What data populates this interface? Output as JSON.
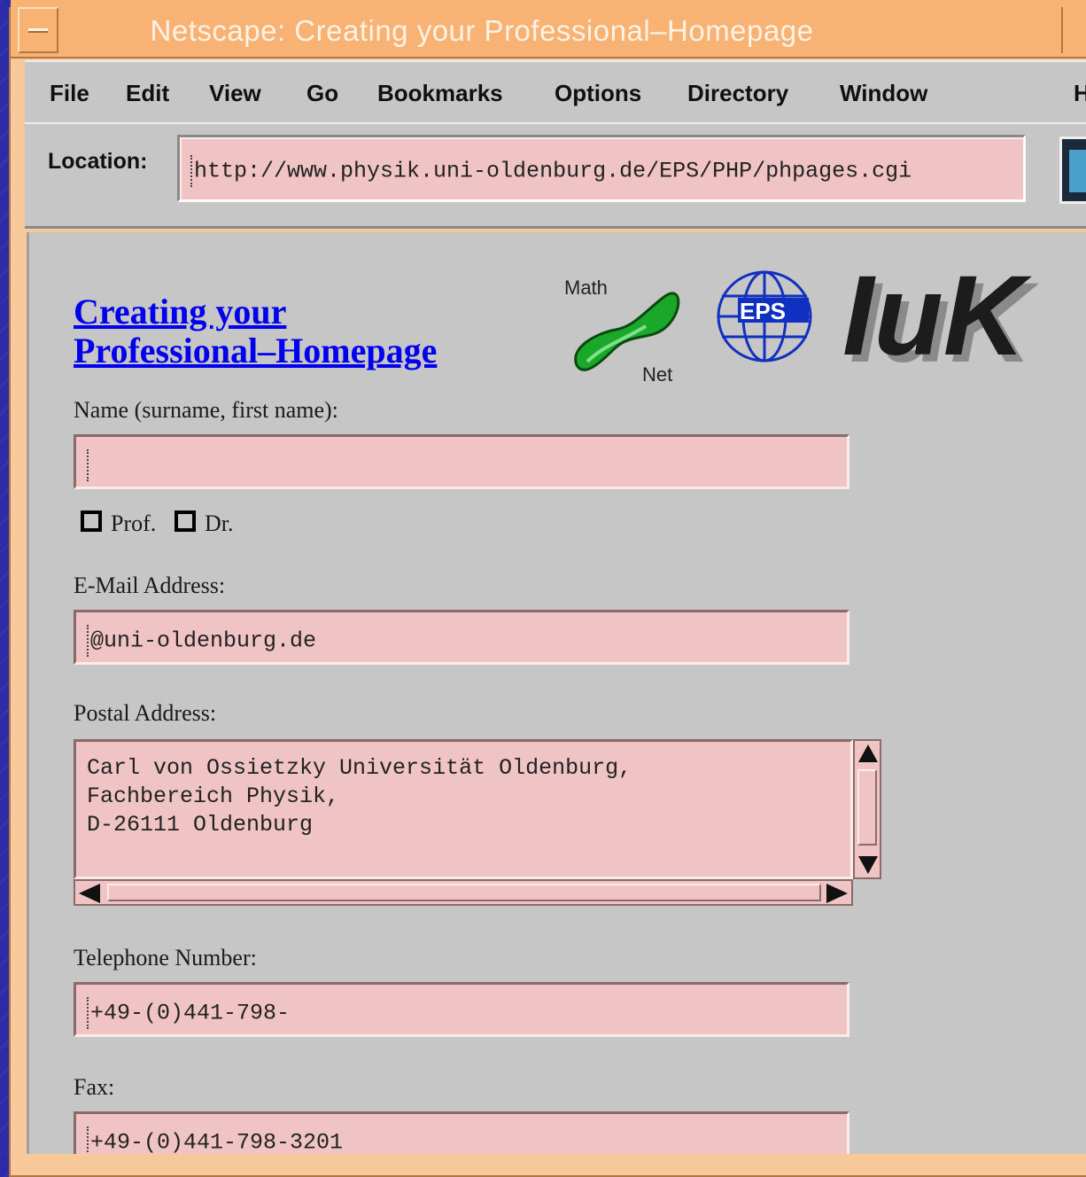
{
  "window": {
    "title": "Netscape: Creating your Professional–Homepage"
  },
  "menubar": {
    "items": [
      "File",
      "Edit",
      "View",
      "Go",
      "Bookmarks",
      "Options",
      "Directory",
      "Window",
      "H"
    ]
  },
  "location": {
    "label": "Location:",
    "url": "http://www.physik.uni-oldenburg.de/EPS/PHP/phpages.cgi"
  },
  "page": {
    "title_line1": "Creating your",
    "title_line2": "Professional–Homepage",
    "logos": {
      "mathnet_top": "Math",
      "mathnet_bottom": "Net",
      "eps": "EPS",
      "iuk": "IuK"
    }
  },
  "form": {
    "name": {
      "label": "Name (surname, first name):",
      "value": ""
    },
    "titles": [
      {
        "label": "Prof.",
        "checked": false
      },
      {
        "label": "Dr.",
        "checked": false
      }
    ],
    "email": {
      "label": "E-Mail Address:",
      "value": "@uni-oldenburg.de"
    },
    "postal": {
      "label": "Postal Address:",
      "value": "Carl von Ossietzky Universität Oldenburg,\nFachbereich Physik,\nD-26111 Oldenburg"
    },
    "phone": {
      "label": "Telephone Number:",
      "value": "+49-(0)441-798-"
    },
    "fax": {
      "label": "Fax:",
      "value": "+49-(0)441-798-3201"
    }
  },
  "colors": {
    "desktop": "#2c2ca8",
    "titlebar": "#f8b274",
    "field": "#f0c4c4",
    "link": "#0000ee",
    "chrome": "#c6c6c6"
  }
}
